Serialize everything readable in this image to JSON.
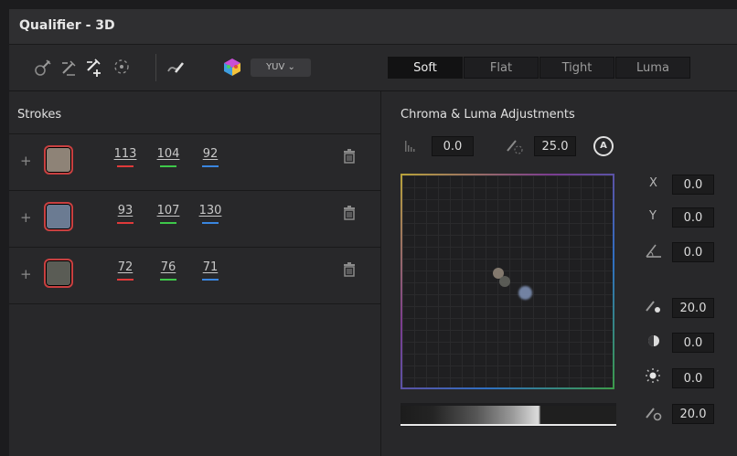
{
  "panel": {
    "title": "Qualifier - 3D"
  },
  "toolbar": {
    "colorspace": "YUV",
    "modes": [
      "Soft",
      "Flat",
      "Tight",
      "Luma"
    ],
    "active_mode": "Soft"
  },
  "strokes": {
    "title": "Strokes",
    "rows": [
      {
        "color": "#8e8377",
        "r": "113",
        "g": "104",
        "b": "92"
      },
      {
        "color": "#6b7b92",
        "r": "93",
        "g": "107",
        "b": "130"
      },
      {
        "color": "#5a5c55",
        "r": "72",
        "g": "76",
        "b": "71"
      }
    ],
    "channel_colors": {
      "r": "#e03a3a",
      "g": "#3ec84a",
      "b": "#3a86e0"
    }
  },
  "adjustments": {
    "title": "Chroma & Luma Adjustments",
    "low_value": "0.0",
    "softness_value": "25.0",
    "auto_label": "A",
    "x_label": "X",
    "x_value": "0.0",
    "y_label": "Y",
    "y_value": "0.0",
    "rotation_value": "0.0",
    "luma_high_value": "20.0",
    "saturation_value": "0.0",
    "luma_value": "0.0",
    "luma_soft_value": "20.0"
  }
}
